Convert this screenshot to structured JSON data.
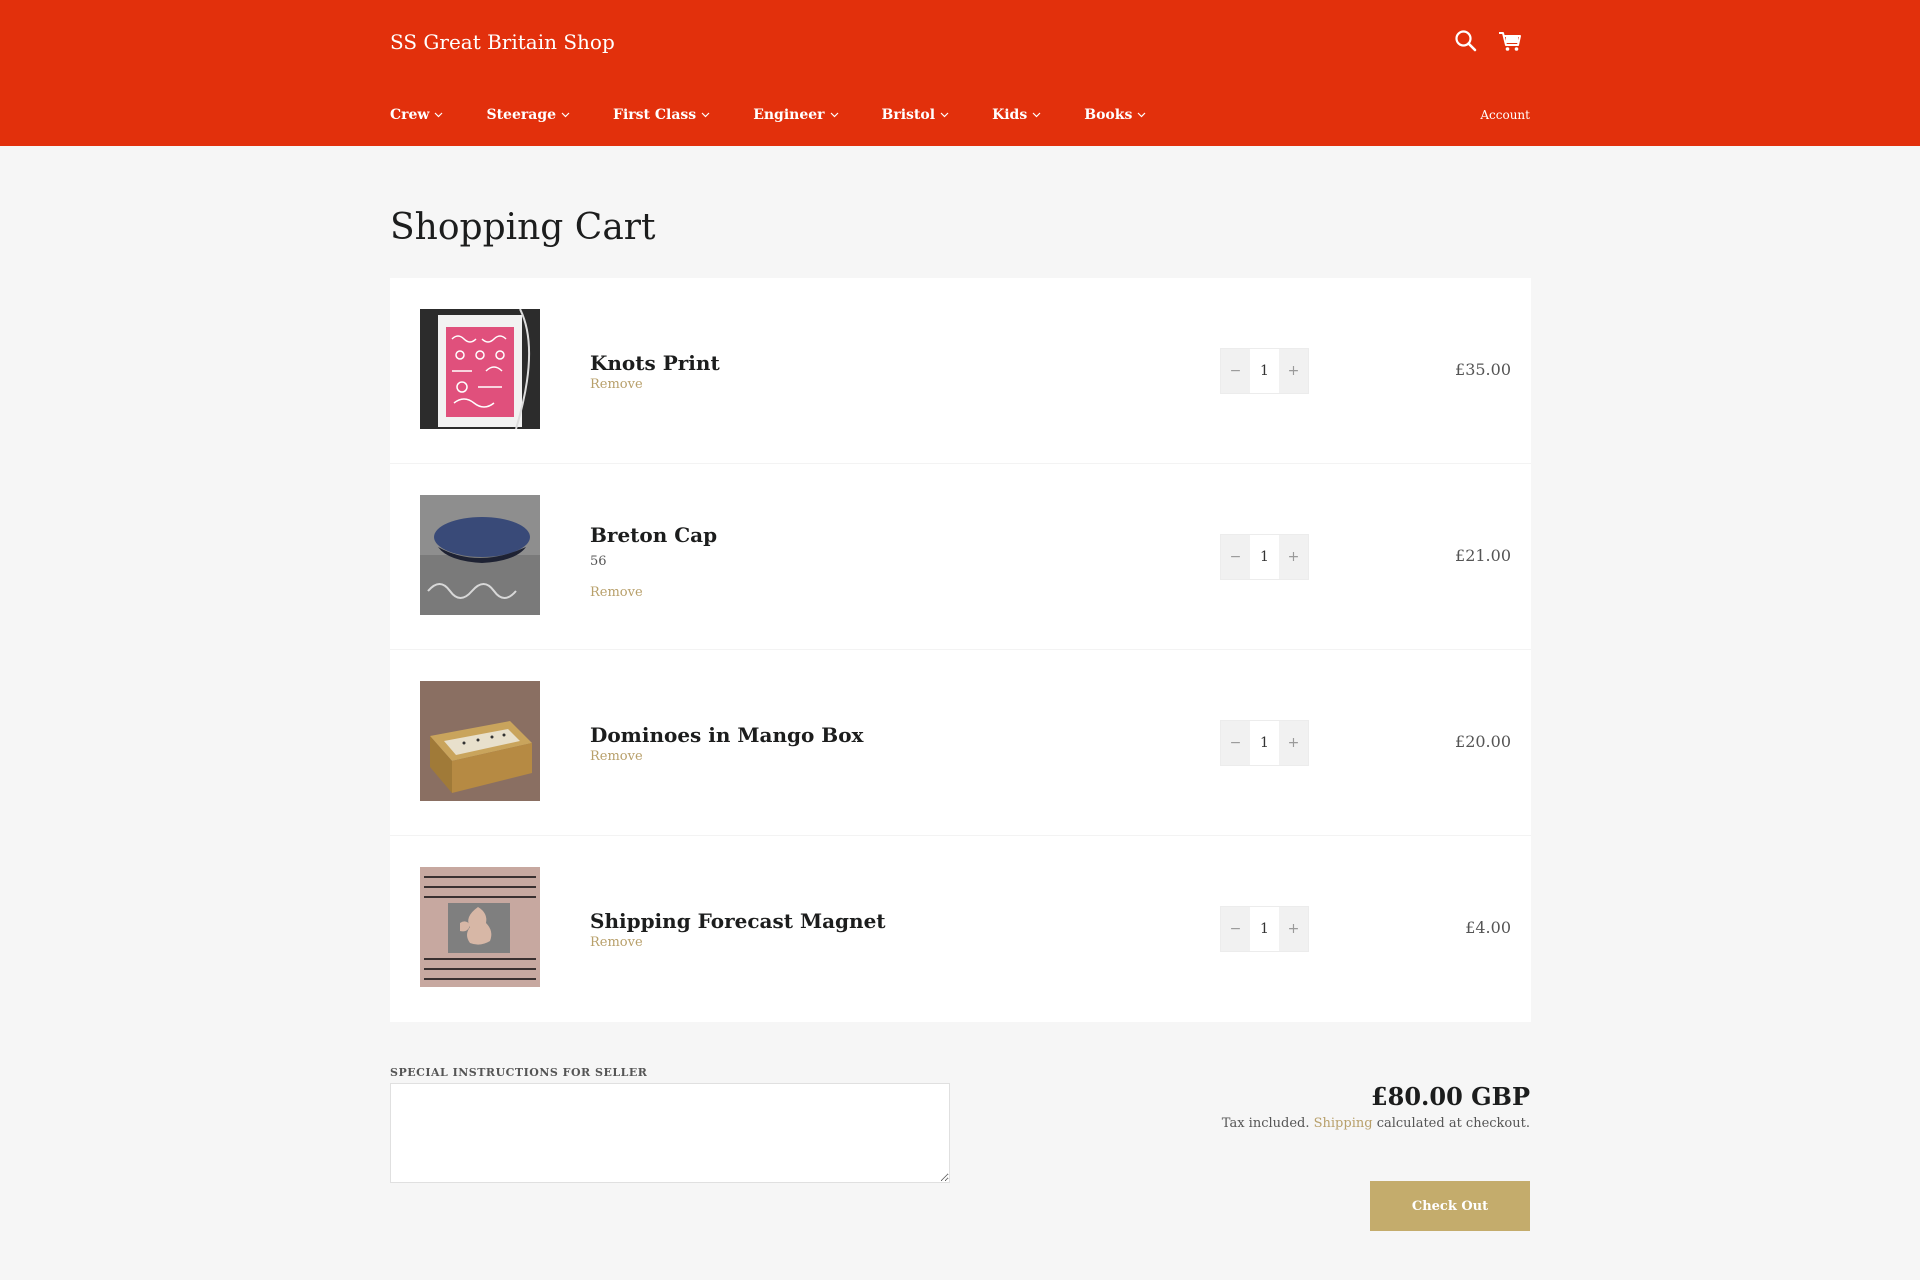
{
  "header": {
    "shop_name": "SS Great Britain Shop",
    "nav": [
      {
        "label": "Crew"
      },
      {
        "label": "Steerage"
      },
      {
        "label": "First Class"
      },
      {
        "label": "Engineer"
      },
      {
        "label": "Bristol"
      },
      {
        "label": "Kids"
      },
      {
        "label": "Books"
      }
    ],
    "account_label": "Account",
    "icons": {
      "search": "search-icon",
      "cart": "cart-icon"
    }
  },
  "page": {
    "title": "Shopping Cart"
  },
  "cart": {
    "items": [
      {
        "title": "Knots Print",
        "variant": "",
        "remove_label": "Remove",
        "quantity": "1",
        "price": "£35.00"
      },
      {
        "title": "Breton Cap",
        "variant": "56",
        "remove_label": "Remove",
        "quantity": "1",
        "price": "£21.00"
      },
      {
        "title": "Dominoes in Mango Box",
        "variant": "",
        "remove_label": "Remove",
        "quantity": "1",
        "price": "£20.00"
      },
      {
        "title": "Shipping Forecast Magnet",
        "variant": "",
        "remove_label": "Remove",
        "quantity": "1",
        "price": "£4.00"
      }
    ],
    "qty_minus": "−",
    "qty_plus": "+"
  },
  "footer": {
    "instructions_label": "SPECIAL INSTRUCTIONS FOR SELLER",
    "instructions_value": "",
    "total": "£80.00 GBP",
    "tax_prefix": "Tax included.",
    "shipping_link": "Shipping",
    "tax_suffix": "calculated at checkout.",
    "checkout_label": "Check Out"
  },
  "colors": {
    "header_bg": "#e2300c",
    "accent": "#b8a06b",
    "checkout_bg": "#c4ac6c",
    "page_bg": "#f6f6f6"
  }
}
